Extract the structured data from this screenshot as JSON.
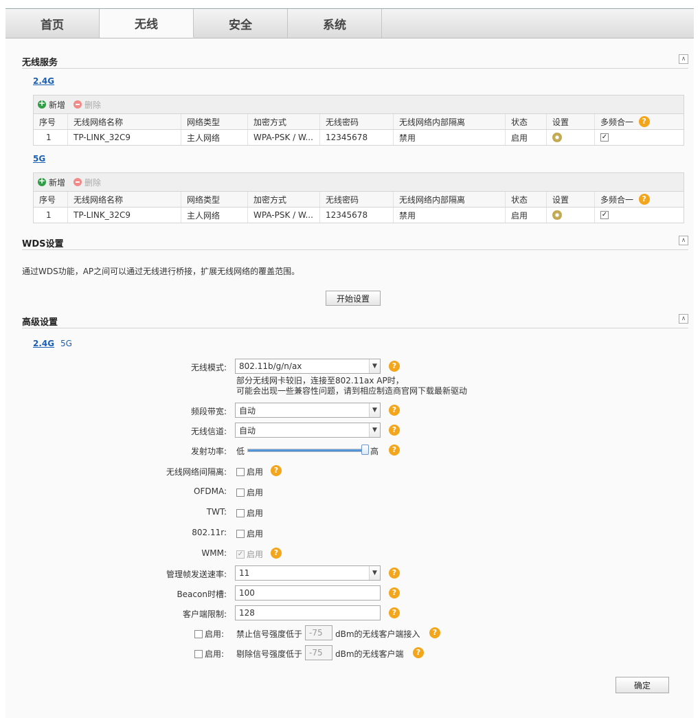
{
  "tabs": [
    "首页",
    "无线",
    "安全",
    "系统"
  ],
  "wireless_service": {
    "title": "无线服务",
    "bands": [
      {
        "label": "2.4G",
        "add_label": "新增",
        "delete_label": "删除",
        "headers": [
          "序号",
          "无线网络名称",
          "网络类型",
          "加密方式",
          "无线密码",
          "无线网络内部隔离",
          "状态",
          "设置",
          "多频合一"
        ],
        "rows": [
          {
            "index": "1",
            "ssid": "TP-LINK_32C9",
            "type": "主人网络",
            "encryption": "WPA-PSK / W...",
            "password": "12345678",
            "isolation": "禁用",
            "status": "启用",
            "multi_band_checked": true
          }
        ]
      },
      {
        "label": "5G",
        "add_label": "新增",
        "delete_label": "删除",
        "headers": [
          "序号",
          "无线网络名称",
          "网络类型",
          "加密方式",
          "无线密码",
          "无线网络内部隔离",
          "状态",
          "设置",
          "多频合一"
        ],
        "rows": [
          {
            "index": "1",
            "ssid": "TP-LINK_32C9",
            "type": "主人网络",
            "encryption": "WPA-PSK / W...",
            "password": "12345678",
            "isolation": "禁用",
            "status": "启用",
            "multi_band_checked": true
          }
        ]
      }
    ]
  },
  "wds": {
    "title": "WDS设置",
    "description": "通过WDS功能，AP之间可以通过无线进行桥接，扩展无线网络的覆盖范围。",
    "start_button": "开始设置"
  },
  "advanced": {
    "title": "高级设置",
    "band_tabs": [
      "2.4G",
      "5G"
    ],
    "wireless_mode": {
      "label": "无线模式:",
      "value": "802.11b/g/n/ax",
      "note_line1": "部分无线网卡较旧，连接至802.11ax AP时，",
      "note_line2": "可能会出现一些兼容性问题，请到相应制造商官网下载最新驱动"
    },
    "bandwidth": {
      "label": "频段带宽:",
      "value": "自动"
    },
    "channel": {
      "label": "无线信道:",
      "value": "自动"
    },
    "tx_power": {
      "label": "发射功率:",
      "low": "低",
      "high": "高",
      "level": 1.0
    },
    "isolation": {
      "label": "无线网络间隔离:",
      "option": "启用",
      "checked": false
    },
    "ofdma": {
      "label": "OFDMA:",
      "option": "启用",
      "checked": false
    },
    "twt": {
      "label": "TWT:",
      "option": "启用",
      "checked": false
    },
    "r80211": {
      "label": "802.11r:",
      "option": "启用",
      "checked": false
    },
    "wmm": {
      "label": "WMM:",
      "option": "启用",
      "checked": true,
      "disabled": true
    },
    "mgmt_rate": {
      "label": "管理帧发送速率:",
      "value": "11"
    },
    "beacon": {
      "label": "Beacon时槽:",
      "value": "100"
    },
    "client_limit": {
      "label": "客户端限制:",
      "value": "128"
    },
    "deny_weak": {
      "label": "启用:",
      "prefix": "禁止信号强度低于",
      "value": "-75",
      "suffix": "dBm的无线客户端接入"
    },
    "kick_weak": {
      "label": "启用:",
      "prefix": "剔除信号强度低于",
      "value": "-75",
      "suffix": "dBm的无线客户端"
    },
    "confirm_button": "确定"
  },
  "colors": {
    "accent_orange": "#f3a51b",
    "link_blue": "#1a5fb4",
    "slider_blue": "#3c86d4"
  }
}
